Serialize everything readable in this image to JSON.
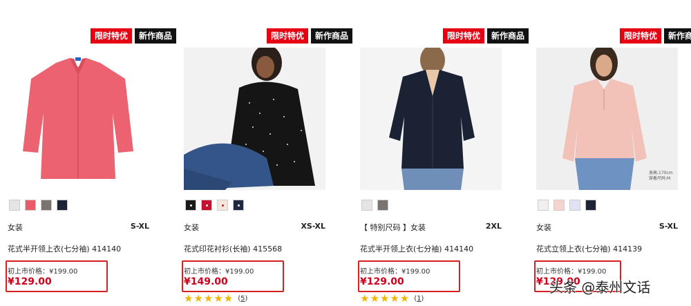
{
  "products": [
    {
      "badges": {
        "sale": "限时特优",
        "new": "新作商品"
      },
      "swatch_colors": [
        "#e5e5e5",
        "#ea5b6a",
        "#7a736f",
        "#1e2437"
      ],
      "category": "女装",
      "size_range": "S-XL",
      "title": "花式半开领上衣(七分袖) 414140",
      "original_price": "初上市价格：¥199.00",
      "price": "¥129.00"
    },
    {
      "badges": {
        "sale": "限时特优",
        "new": "新作商品"
      },
      "swatch_colors": [
        "#1a1a1a",
        "#c8102e",
        "#f3e6da",
        "#1f2942"
      ],
      "category": "女装",
      "size_range": "XS-XL",
      "title": "花式印花衬衫(长袖) 415568",
      "original_price": "初上市价格：¥199.00",
      "price": "¥149.00",
      "rating": {
        "stars": "★★★★★",
        "count": "5",
        "value": 5
      }
    },
    {
      "badges": {
        "sale": "限时特优",
        "new": "新作商品"
      },
      "swatch_colors": [
        "#e5e5e5",
        "#7a736f"
      ],
      "category": "【 特别尺码 】女装",
      "size_range": "2XL",
      "title": "花式半开领上衣(七分袖) 414140",
      "original_price": "初上市价格：¥199.00",
      "price": "¥129.00",
      "rating": {
        "stars": "★★★★★",
        "count": "1",
        "value": 5
      }
    },
    {
      "badges": {
        "sale": "限时特优",
        "new": "新作商品"
      },
      "swatch_colors": [
        "#f2f0ee",
        "#f5d3cf",
        "#dfe3f4",
        "#1e2437"
      ],
      "category": "女装",
      "size_range": "S-XL",
      "title": "花式立领上衣(七分袖) 414139",
      "original_price": "初上市价格：¥199.00",
      "price": "¥129.00",
      "photo_note": [
        "身高:170cm",
        "穿着尺码:M"
      ]
    }
  ],
  "watermark": "头条 @泰州文话",
  "colors": {
    "sale_red": "#e60012",
    "price_red": "#d0021b",
    "highlight_box": "#d42020",
    "star": "#f2b400"
  }
}
